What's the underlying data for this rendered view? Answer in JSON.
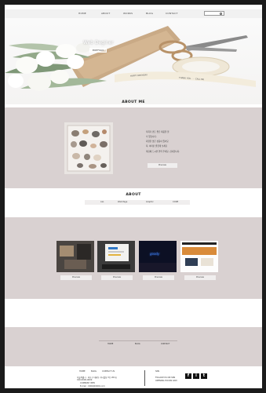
{
  "nav": {
    "items": [
      "HOME",
      "ABOUT",
      "WORKS",
      "BLOG",
      "CONTACT"
    ]
  },
  "hero": {
    "title": "Web Deginer",
    "button": "PORTFOLIO",
    "tape_text_1": "HAPPY BIRTHDAY",
    "tape_text_2": "THANK YOU · · · CALL ME"
  },
  "about_me": {
    "title": "ABOUT ME",
    "lines": [
      "저희가 만든 좋은 제품을 볼",
      "수 있습니다.",
      "다양한 많은 상품이 있어요",
      "자, 여러분 즐겁게 보세요",
      "마음에 드시면 연락 주세요. 감사합니다."
    ],
    "button": "Preview"
  },
  "about": {
    "title": "ABOUT",
    "tabs": [
      "ALL",
      "Web Page",
      "Graphic",
      "CODE"
    ]
  },
  "works": {
    "items": [
      {
        "button": "Preview"
      },
      {
        "button": "Preview"
      },
      {
        "button": "Preview",
        "screen_text": "goody"
      },
      {
        "button": "Preview"
      }
    ]
  },
  "footer_links": [
    "HOME",
    "BLOG",
    "CONTACT"
  ],
  "footer": {
    "nav": [
      "HOME",
      "BLOG",
      "CONTACT US"
    ],
    "addr_1": "서울특별시 · 마포구 대흥동 가나빌딩 3층 201호",
    "addr_2": "010-0000-0000",
    "addr_3": "COMPANY INFO",
    "addr_4": "E-mail : 0000@0000.com",
    "sns_label": "SNS",
    "sns_1": "FOLLOW US ON SNS",
    "sns_2": "OPENING HOURS 9AM",
    "sns_icons": [
      "f",
      "i",
      "t"
    ]
  },
  "colors": {
    "band": "#d9d1d1",
    "button_bg": "#f0eeee"
  }
}
